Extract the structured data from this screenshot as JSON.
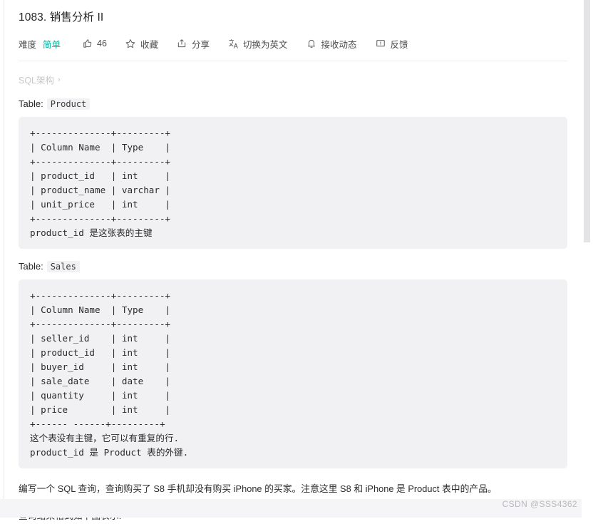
{
  "problem": {
    "title": "1083. 销售分析 II"
  },
  "toolbar": {
    "difficulty_label": "难度",
    "difficulty_value": "简单",
    "like_count": "46",
    "like_icon": "thumbs-up-icon",
    "favorite_label": "收藏",
    "favorite_icon": "star-icon",
    "share_label": "分享",
    "share_icon": "share-icon",
    "translate_label": "切换为英文",
    "translate_icon": "translate-icon",
    "subscribe_label": "接收动态",
    "subscribe_icon": "bell-icon",
    "feedback_label": "反馈",
    "feedback_icon": "comment-icon"
  },
  "breadcrumb": {
    "label": "SQL架构",
    "separator": "›"
  },
  "sections": [
    {
      "caption_label": "Table:",
      "caption_table": "Product",
      "code": "+--------------+---------+\n| Column Name  | Type    |\n+--------------+---------+\n| product_id   | int     |\n| product_name | varchar |\n| unit_price   | int     |\n+--------------+---------+\nproduct_id 是这张表的主键"
    },
    {
      "caption_label": "Table:",
      "caption_table": "Sales",
      "code": "+--------------+---------+\n| Column Name  | Type    |\n+--------------+---------+\n| seller_id    | int     |\n| product_id   | int     |\n| buyer_id     | int     |\n| sale_date    | date    |\n| quantity     | int     |\n| price        | int     |\n+------ ------+---------+\n这个表没有主键，它可以有重复的行.\nproduct_id 是 Product 表的外键."
    }
  ],
  "paragraphs": {
    "task": "编写一个 SQL 查询，查询购买了 S8 手机却没有购买 iPhone 的买家。注意这里 S8 和 iPhone 是 Product 表中的产品。",
    "result_note": "查询结果格式如下图表示:"
  },
  "watermark": {
    "text": "CSDN @SSS4362"
  },
  "colors": {
    "difficulty_easy": "#00af9b",
    "code_background": "#f1f1f3",
    "text_primary": "#262626",
    "breadcrumb": "#c8c8cc"
  }
}
